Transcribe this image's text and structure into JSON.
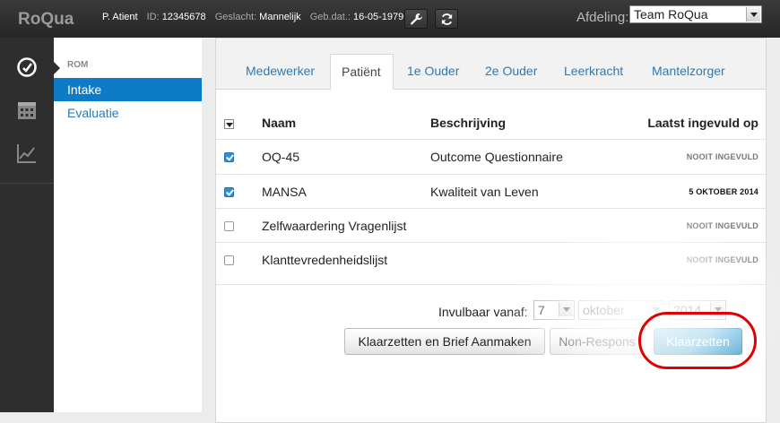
{
  "topbar": {
    "brand": "RoQua",
    "patient_name": "P. Atient",
    "id_label": "ID:",
    "id_value": "12345678",
    "gender_label": "Geslacht:",
    "gender_value": "Mannelijk",
    "dob_label": "Geb.dat.:",
    "dob_value": "16-05-1979",
    "department_label": "Afdeling:",
    "department_value": "Team RoQua"
  },
  "rail": {
    "icons": [
      "dashboard-icon",
      "calendar-icon",
      "chart-icon"
    ]
  },
  "subnav": {
    "header": "ROM",
    "items": [
      {
        "label": "Intake",
        "active": true
      },
      {
        "label": "Evaluatie",
        "active": false
      }
    ]
  },
  "tabs": [
    {
      "label": "Medewerker",
      "active": false
    },
    {
      "label": "Patiënt",
      "active": true
    },
    {
      "label": "1e Ouder",
      "active": false
    },
    {
      "label": "2e Ouder",
      "active": false
    },
    {
      "label": "Leerkracht",
      "active": false
    },
    {
      "label": "Mantelzorger",
      "active": false
    }
  ],
  "table": {
    "headers": [
      "Naam",
      "Beschrijving",
      "Laatst ingevuld op"
    ],
    "rows": [
      {
        "name": "OQ-45",
        "description": "Outcome Questionnaire",
        "last": "NOOIT INGEVULD",
        "checked": true
      },
      {
        "name": "MANSA",
        "description": "Kwaliteit van Leven",
        "last": "5 OKTOBER 2014",
        "checked": true
      },
      {
        "name": "Zelfwaardering Vragenlijst",
        "description": "",
        "last": "NOOIT INGEVULD",
        "checked": false
      },
      {
        "name": "Klanttevredenheidslijst",
        "description": "",
        "last": "NOOIT INGEVULD",
        "checked": false
      }
    ]
  },
  "footer": {
    "available_label": "Invulbaar vanaf:",
    "day": "7",
    "month": "oktober",
    "year": "2014",
    "btn_letter": "Klaarzetten en Brief Aanmaken",
    "btn_nonresponse": "Non-Respons",
    "btn_ready": "Klaarzetten"
  },
  "colors": {
    "accent": "#0e7bc6",
    "primary_button": "#3ea3d6",
    "highlight_ring": "#e00000"
  }
}
